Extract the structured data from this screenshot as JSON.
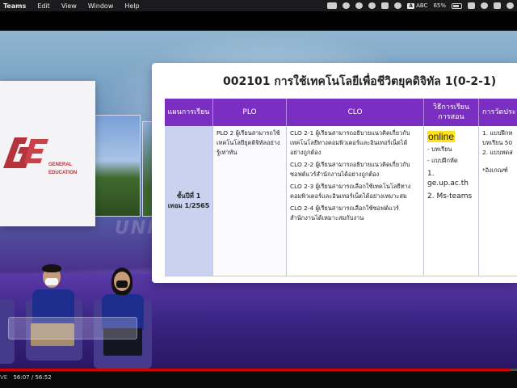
{
  "menubar": {
    "app": "Teams",
    "items": [
      "Edit",
      "View",
      "Window",
      "Help"
    ],
    "input_source": "ABC",
    "battery": "65%"
  },
  "slide": {
    "title": "002101  การใช้เทคโนโลยีเพื่อชีวิตยุคดิจิทัล 1(0-2-1)",
    "headers": [
      "แผนการเรียน",
      "PLO",
      "CLO",
      "วิธีการเรียน\nการสอน",
      "การวัดประ"
    ],
    "plan": "ชั้นปีที่ 1\nเทอม 1/2565",
    "plo": "PLO 2 ผู้เรียนสามารถใช้เทคโนโลยียุคดิจิทัลอย่างรู้เท่าทัน",
    "clos": [
      "CLO 2-1 ผู้เรียนสามารถอธิบายแนวคิดเกี่ยวกับเทคโนโลยีทางคอมพิวเตอร์และอินเทอร์เน็ตได้อย่างถูกต้อง",
      "CLO 2-2 ผู้เรียนสามารถอธิบายแนวคิดเกี่ยวกับซอฟต์แวร์สำนักงานได้อย่างถูกต้อง",
      "CLO 2-3 ผู้เรียนสามารถเลือกใช้เทคโนโลยีทางคอมพิวเตอร์และอินเทอร์เน็ตได้อย่างเหมาะสม",
      "CLO 2-4 ผู้เรียนสามารถเลือกใช้ซอฟต์แวร์สำนักงานได้เหมาะสมกับงาน"
    ],
    "method": {
      "highlight": "online",
      "lines": [
        "- บทเรียน",
        "- แบบฝึกหัด"
      ],
      "links": [
        "1. ge.up.ac.th",
        "2. Ms-teams"
      ]
    },
    "assessment": [
      "1. แบบฝึกห",
      "บทเรียน 50",
      "2. แบบทดส",
      "",
      "*อิงเกณฑ์"
    ]
  },
  "logo": {
    "line1": "GENERAL",
    "line2": "EDUCATION"
  },
  "background_text": "UNIV",
  "player": {
    "live": "VE",
    "current": "56:07",
    "separator": "/",
    "duration": "56:52",
    "progress_fraction": 0.987
  }
}
